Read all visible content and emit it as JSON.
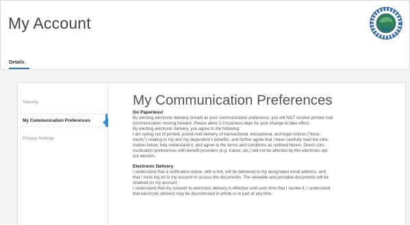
{
  "header": {
    "title": "My Account",
    "logo_alt": "circular union emblem"
  },
  "tabs": [
    {
      "label": "Details",
      "active": true
    }
  ],
  "sidebar": {
    "items": [
      {
        "label": "Security",
        "active": false
      },
      {
        "label": "My Communication Preferences",
        "active": true
      },
      {
        "label": "Privacy Settings",
        "active": false
      }
    ]
  },
  "main": {
    "title": "My Communication Preferences",
    "sections": [
      {
        "heading": "Go Paperless!",
        "lines": [
          "By electing electronic delivery (email) as your communication preference, you will NOT receive printed mail",
          "communication moving forward. Please allow 2-3 business days for your change to take effect.",
          "By electing electronic delivery, you agree to the following:",
          "I am opting out of printed, postal mail delivery of transactional, educational, and legal notices (“docu-",
          "ments”) relating to my and my dependent’s benefits, and further agree that I have carefully read the infor-",
          "mation below, fully understand it, and agree to the terms and conditions as outlined herein. Direct com-",
          "munication preferences with benefit providers (e.g. Kaiser, etc.) will not be affected by this electronic opt-",
          "out election."
        ]
      },
      {
        "heading": "Electronic Delivery",
        "lines": [
          "I understand that a notification notice, with a link, will be delivered to my designated email address, and",
          "that I must log on to my account to access the documents. The viewable and printable documents will be",
          "retained on my account.",
          "I understand that my consent to electronic delivery is effective until such time that I revoke it. I understand",
          "that electronic delivery may be discontinued in whole or in part at any time."
        ]
      }
    ]
  },
  "colors": {
    "accent": "#2a8fd6",
    "tab_underline": "#2a6fb5",
    "background": "#f3f3f3"
  }
}
